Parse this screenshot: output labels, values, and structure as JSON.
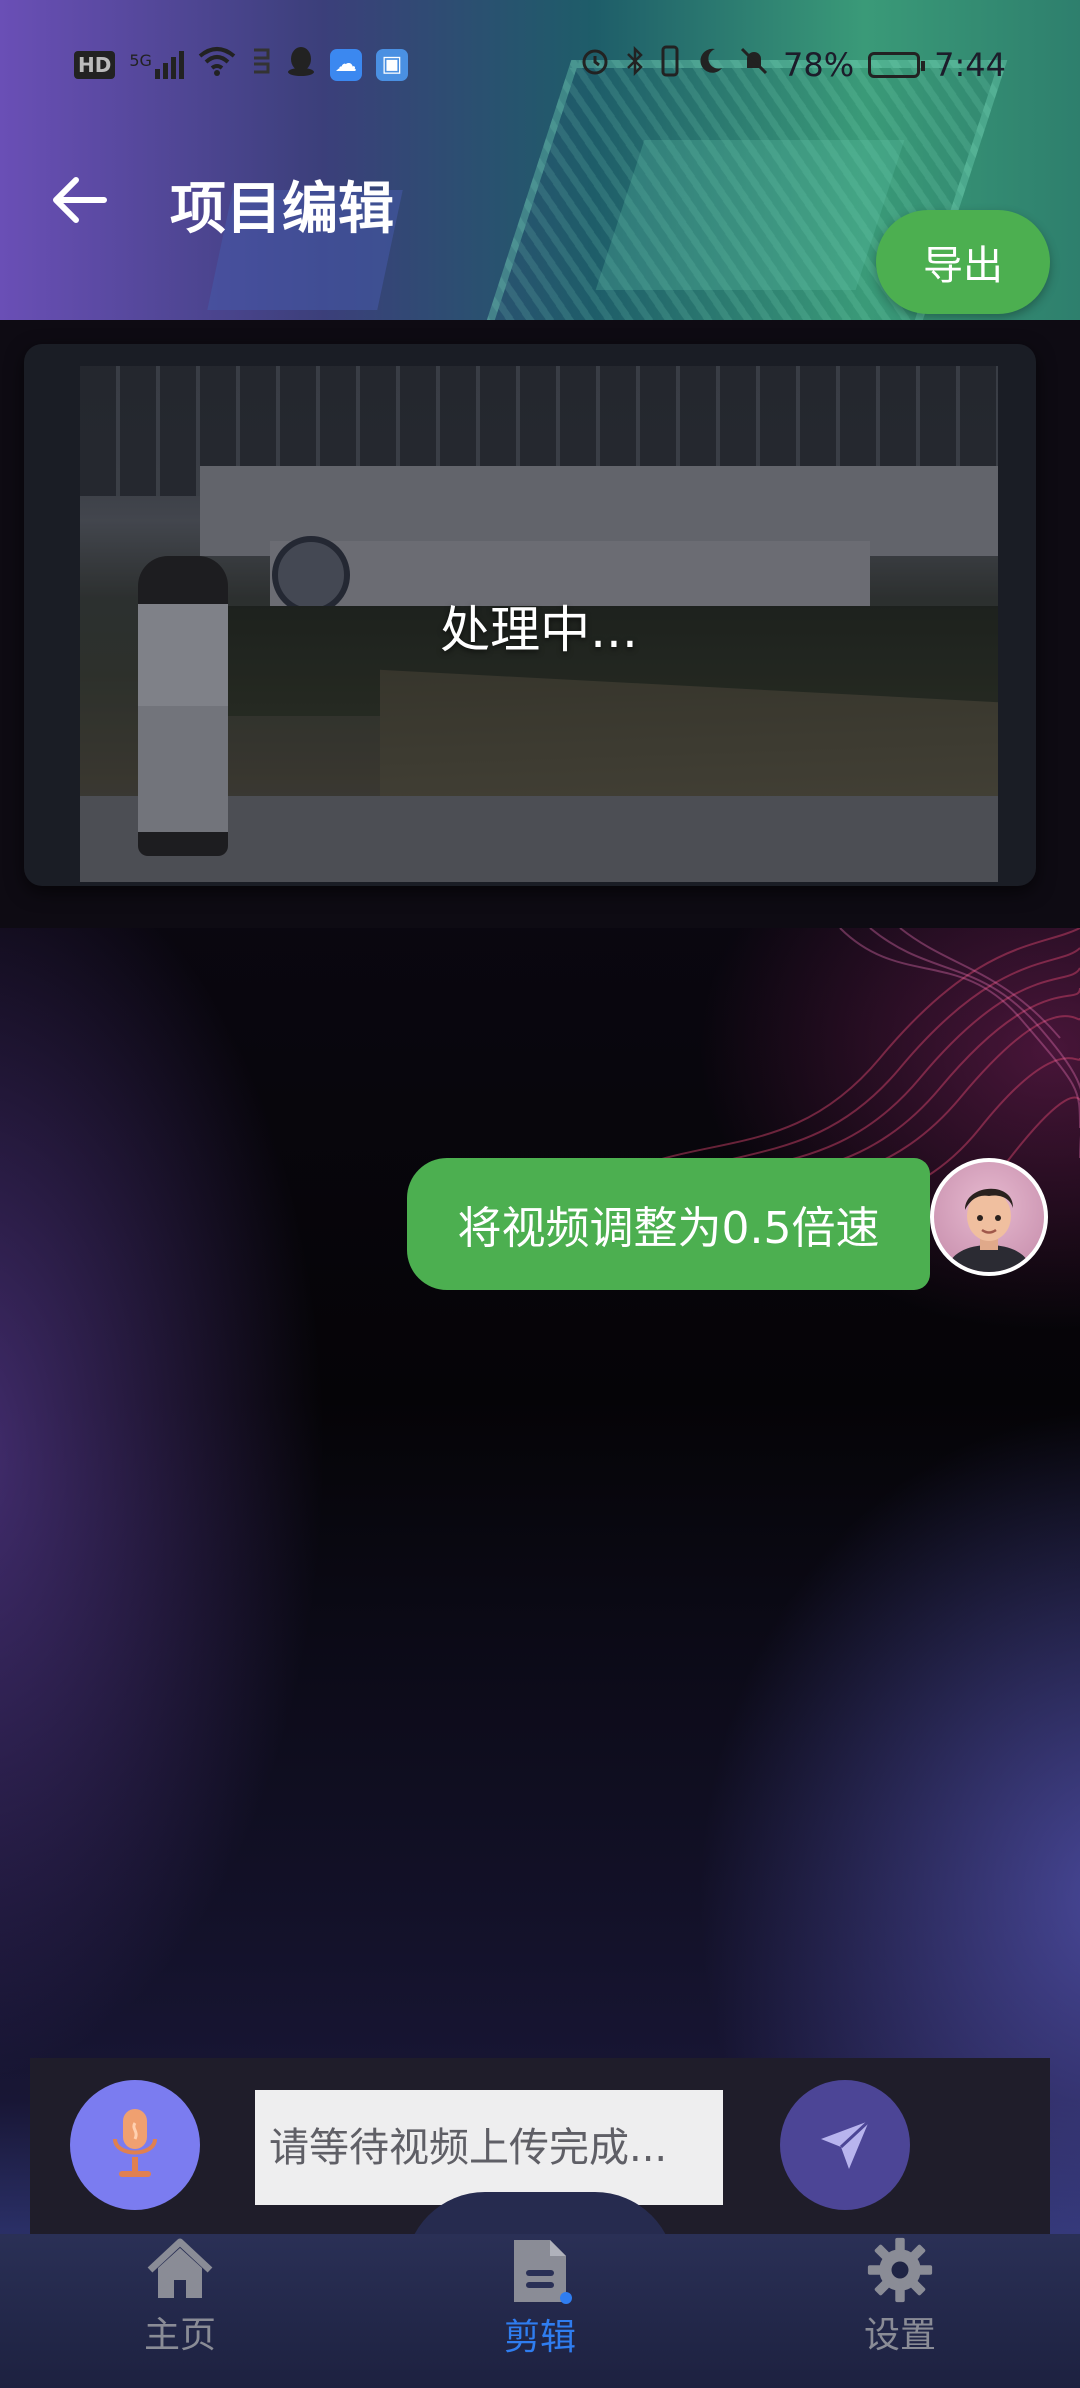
{
  "status_bar": {
    "left_icons": [
      "hd-icon",
      "signal-5g-icon",
      "wifi-icon",
      "nfc-icon",
      "qq-icon",
      "cloud-app-icon",
      "app-badge-icon"
    ],
    "hd": "HD",
    "network": "5G",
    "right_icons": [
      "alarm-icon",
      "bluetooth-icon",
      "vibrate-icon",
      "moon-icon",
      "mute-icon"
    ],
    "battery_percent": "78%",
    "time": "7:44"
  },
  "header": {
    "title": "项目编辑",
    "export_label": "导出"
  },
  "video": {
    "status_text": "处理中..."
  },
  "chat": {
    "messages": [
      {
        "role": "user",
        "text": "将视频调整为0.5倍速"
      }
    ]
  },
  "input": {
    "placeholder": "请等待视频上传完成..."
  },
  "nav": {
    "items": [
      {
        "label": "主页",
        "icon": "home-icon",
        "active": false
      },
      {
        "label": "剪辑",
        "icon": "document-icon",
        "active": true
      },
      {
        "label": "设置",
        "icon": "gear-icon",
        "active": false
      }
    ]
  },
  "colors": {
    "accent_green": "#4caf50",
    "nav_active": "#2f7df0",
    "nav_inactive": "#8a8c96",
    "mic_button": "#7b7cf0",
    "send_button": "#4c4596"
  }
}
